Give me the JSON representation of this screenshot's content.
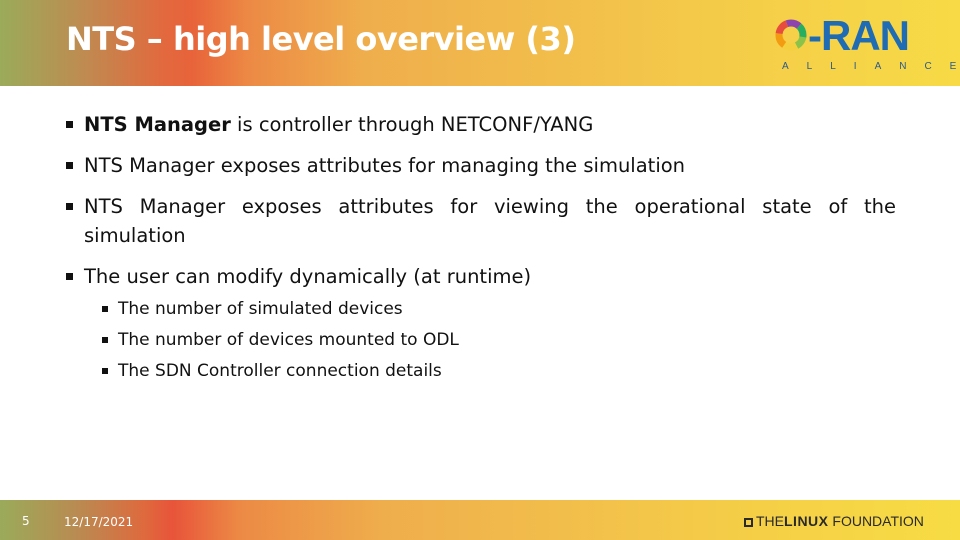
{
  "header": {
    "title": "NTS – high level overview (3)",
    "logo": {
      "name": "O-RAN",
      "text": "-RAN",
      "subtitle": "ALLIANCE",
      "color": "#1f6cb4"
    }
  },
  "bullets": [
    {
      "bold": "NTS Manager",
      "rest": " is controller through NETCONF/YANG"
    },
    {
      "bold": "",
      "rest": "NTS Manager exposes attributes for managing the simulation"
    },
    {
      "bold": "",
      "rest": "NTS Manager exposes attributes for viewing the operational state of the simulation"
    },
    {
      "bold": "",
      "rest": "The user can modify dynamically (at runtime)"
    }
  ],
  "sub_bullets": [
    "The number of simulated devices",
    "The number of devices mounted to ODL",
    "The SDN Controller connection details"
  ],
  "footer": {
    "page_number": "5",
    "date": "12/17/2021",
    "organization": {
      "pre": "THE",
      "bold": "LINUX",
      "post": " FOUNDATION"
    }
  }
}
